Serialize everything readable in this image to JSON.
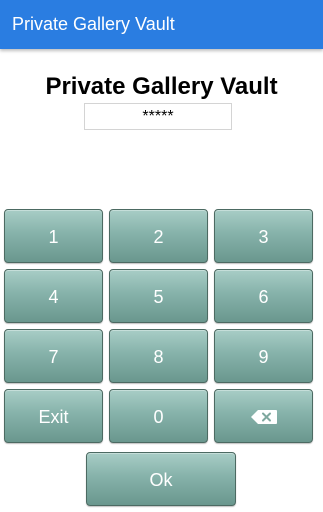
{
  "appbar": {
    "title": "Private Gallery Vault",
    "color": "#2a7de1"
  },
  "header": {
    "title": "Private Gallery Vault"
  },
  "pin": {
    "value": "*****"
  },
  "keypad": {
    "key_1": "1",
    "key_2": "2",
    "key_3": "3",
    "key_4": "4",
    "key_5": "5",
    "key_6": "6",
    "key_7": "7",
    "key_8": "8",
    "key_9": "9",
    "exit": "Exit",
    "key_0": "0",
    "backspace_icon": "backspace-icon",
    "ok": "Ok",
    "key_color": "#86b2aa"
  }
}
